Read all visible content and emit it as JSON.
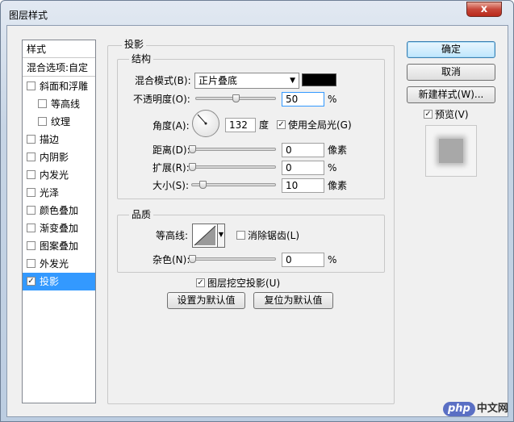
{
  "window": {
    "title": "图层样式",
    "close_label": "x"
  },
  "sidebar": {
    "header": "样式",
    "blend_options": "混合选项:自定",
    "items": [
      {
        "label": "斜面和浮雕",
        "checked": false,
        "indent": false
      },
      {
        "label": "等高线",
        "checked": false,
        "indent": true
      },
      {
        "label": "纹理",
        "checked": false,
        "indent": true
      },
      {
        "label": "描边",
        "checked": false,
        "indent": false
      },
      {
        "label": "内阴影",
        "checked": false,
        "indent": false
      },
      {
        "label": "内发光",
        "checked": false,
        "indent": false
      },
      {
        "label": "光泽",
        "checked": false,
        "indent": false
      },
      {
        "label": "颜色叠加",
        "checked": false,
        "indent": false
      },
      {
        "label": "渐变叠加",
        "checked": false,
        "indent": false
      },
      {
        "label": "图案叠加",
        "checked": false,
        "indent": false
      },
      {
        "label": "外发光",
        "checked": false,
        "indent": false
      },
      {
        "label": "投影",
        "checked": true,
        "indent": false,
        "selected": true
      }
    ]
  },
  "panel": {
    "title": "投影",
    "structure": {
      "title": "结构",
      "blend_mode_label": "混合模式(B):",
      "blend_mode_value": "正片叠底",
      "shadow_color": "#000000",
      "opacity_label": "不透明度(O):",
      "opacity_value": "50",
      "opacity_unit": "%",
      "angle_label": "角度(A):",
      "angle_value": "132",
      "angle_unit": "度",
      "global_light_label": "使用全局光(G)",
      "global_light_checked": true,
      "distance_label": "距离(D):",
      "distance_value": "0",
      "distance_unit": "像素",
      "spread_label": "扩展(R):",
      "spread_value": "0",
      "spread_unit": "%",
      "size_label": "大小(S):",
      "size_value": "10",
      "size_unit": "像素"
    },
    "quality": {
      "title": "品质",
      "contour_label": "等高线:",
      "antialias_label": "消除锯齿(L)",
      "antialias_checked": false,
      "noise_label": "杂色(N):",
      "noise_value": "0",
      "noise_unit": "%"
    },
    "knockout_label": "图层挖空投影(U)",
    "knockout_checked": true,
    "make_default_label": "设置为默认值",
    "reset_default_label": "复位为默认值"
  },
  "buttons": {
    "ok": "确定",
    "cancel": "取消",
    "new_style": "新建样式(W)...",
    "preview_label": "预览(V)",
    "preview_checked": true
  },
  "watermark": {
    "logo": "php",
    "text": "中文网"
  }
}
